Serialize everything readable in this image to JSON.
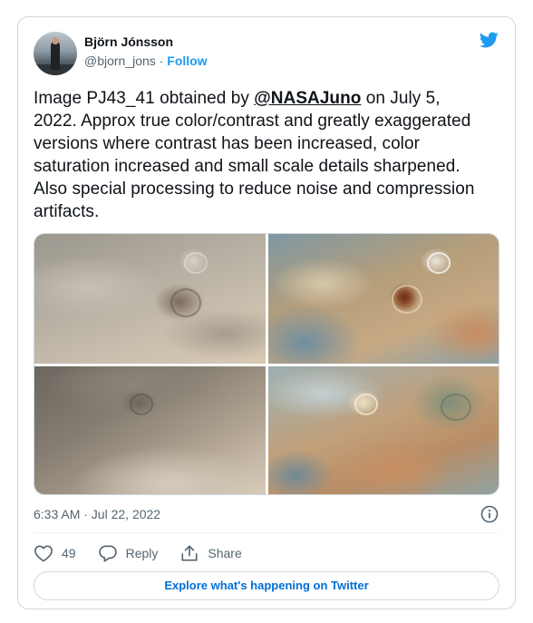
{
  "author": {
    "name": "Björn Jónsson",
    "handle": "@bjorn_jons",
    "separator": "·",
    "follow_label": "Follow",
    "avatar_icon": "profile-photo"
  },
  "brand": {
    "icon": "twitter-bird-icon",
    "color": "#1d9bf0"
  },
  "tweet": {
    "text_before": "Image PJ43_41 obtained by ",
    "mention": "@NASAJuno",
    "text_after": " on July 5, 2022. Approx true color/contrast and greatly exaggerated versions where contrast has been increased, color saturation increased and small scale details sharpened. Also special processing to reduce noise and compression artifacts.",
    "timestamp": "6:33 AM · Jul 22, 2022"
  },
  "media": {
    "images": [
      {
        "label": "jupiter-image-approx-true-color-1"
      },
      {
        "label": "jupiter-image-enhanced-1"
      },
      {
        "label": "jupiter-image-approx-true-color-2"
      },
      {
        "label": "jupiter-image-enhanced-2"
      }
    ]
  },
  "actions": {
    "like_count": "49",
    "reply_label": "Reply",
    "share_label": "Share"
  },
  "footer": {
    "explore_label": "Explore what's happening on Twitter"
  }
}
